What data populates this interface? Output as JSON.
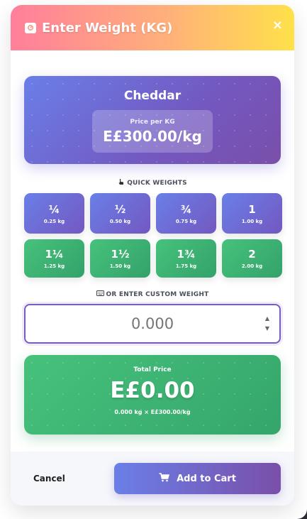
{
  "header": {
    "title": "Enter Weight (KG)",
    "close_label": "×",
    "icon": "weight-scale-icon"
  },
  "product": {
    "name": "Cheddar",
    "price_label": "Price per KG",
    "price_value": "E£300.00/kg"
  },
  "quick": {
    "label": "QUICK WEIGHTS",
    "icon": "pointing-hand-icon",
    "items": [
      {
        "frac": "¼",
        "kg": "0.25 kg",
        "color": "#6a7fe8"
      },
      {
        "frac": "½",
        "kg": "0.50 kg",
        "color": "#6a7fe8"
      },
      {
        "frac": "¾",
        "kg": "0.75 kg",
        "color": "#6a7fe8"
      },
      {
        "frac": "1",
        "kg": "1.00 kg",
        "color": "#6a7fe8"
      },
      {
        "frac": "1¼",
        "kg": "1.25 kg",
        "color": "#46c27b"
      },
      {
        "frac": "1½",
        "kg": "1.50 kg",
        "color": "#46c27b"
      },
      {
        "frac": "1¾",
        "kg": "1.75 kg",
        "color": "#46c27b"
      },
      {
        "frac": "2",
        "kg": "2.00 kg",
        "color": "#46c27b"
      }
    ]
  },
  "custom": {
    "label": "OR ENTER CUSTOM WEIGHT",
    "icon": "keyboard-icon",
    "placeholder": "0.000",
    "value": ""
  },
  "total": {
    "label": "Total Price",
    "value": "E£0.00",
    "formula": "0.000 kg × E£300.00/kg"
  },
  "footer": {
    "cancel_label": "Cancel",
    "add_label": "Add to Cart",
    "add_icon": "cart-icon"
  }
}
